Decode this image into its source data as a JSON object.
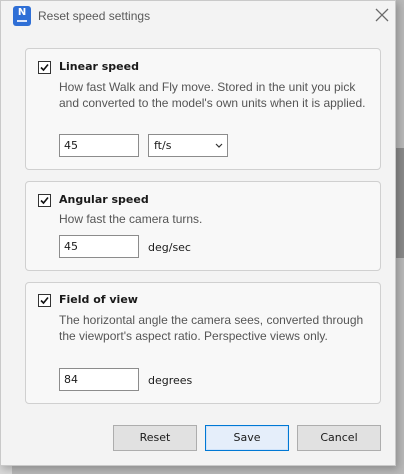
{
  "window": {
    "title": "Reset speed settings",
    "app_icon_letter": "N"
  },
  "groups": [
    {
      "label": "Linear speed",
      "checked": true,
      "description": "How fast Walk and Fly move. Stored in the unit you pick and converted to the model's own units when it is applied.",
      "value": "45",
      "unit_select": "ft/s"
    },
    {
      "label": "Angular speed",
      "checked": true,
      "description": "How fast the camera turns.",
      "value": "45",
      "unit": "deg/sec"
    },
    {
      "label": "Field of view",
      "checked": true,
      "description": "The horizontal angle the camera sees, converted through the viewport's aspect ratio. Perspective views only.",
      "value": "84",
      "unit": "degrees"
    }
  ],
  "buttons": {
    "reset": "Reset",
    "save": "Save",
    "cancel": "Cancel"
  },
  "icons": {
    "close": "close-icon",
    "check": "checkmark-icon",
    "dropdown": "chevron-down-icon"
  },
  "colors": {
    "accent": "#0078d4",
    "app_icon": "#2f6fd6"
  }
}
